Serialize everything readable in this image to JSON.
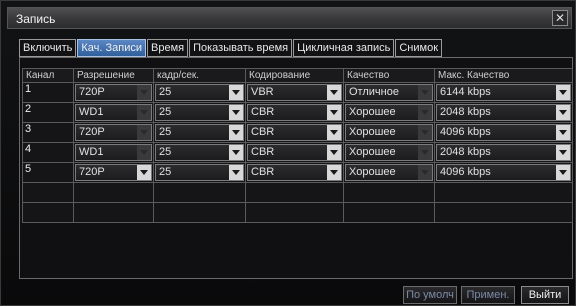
{
  "window": {
    "title": "Запись"
  },
  "tabs": [
    {
      "label": "Включить",
      "active": false
    },
    {
      "label": "Кач. Записи",
      "active": true
    },
    {
      "label": "Время",
      "active": false
    },
    {
      "label": "Показывать время",
      "active": false
    },
    {
      "label": "Цикличная запись",
      "active": false
    },
    {
      "label": "Снимок",
      "active": false
    }
  ],
  "table": {
    "headers": [
      "Канал",
      "Разрешение",
      "кадр/сек.",
      "Кодирование",
      "Качество",
      "Макс. Качество"
    ],
    "rows": [
      {
        "channel": "1",
        "resolution": "720P",
        "fps": "25",
        "encoding": "VBR",
        "quality": "Отличное",
        "max_quality": "6144 kbps"
      },
      {
        "channel": "2",
        "resolution": "WD1",
        "fps": "25",
        "encoding": "CBR",
        "quality": "Хорошее",
        "max_quality": "2048 kbps"
      },
      {
        "channel": "3",
        "resolution": "720P",
        "fps": "25",
        "encoding": "CBR",
        "quality": "Хорошее",
        "max_quality": "4096 kbps"
      },
      {
        "channel": "4",
        "resolution": "WD1",
        "fps": "25",
        "encoding": "CBR",
        "quality": "Хорошее",
        "max_quality": "2048 kbps"
      },
      {
        "channel": "5",
        "resolution": "720P",
        "fps": "25",
        "encoding": "CBR",
        "quality": "Хорошее",
        "max_quality": "4096 kbps"
      }
    ]
  },
  "buttons": {
    "default": "По умолч",
    "apply": "Примен.",
    "exit": "Выйти"
  }
}
